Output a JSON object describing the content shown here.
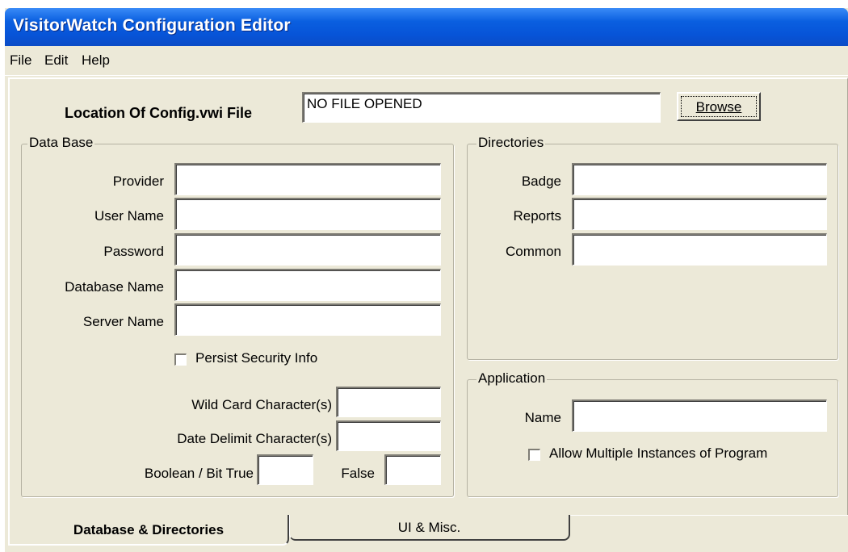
{
  "window": {
    "title": "VisitorWatch Configuration Editor"
  },
  "menu": [
    "File",
    "Edit",
    "Help"
  ],
  "config": {
    "label": "Location Of Config.vwi File",
    "path_value": "NO FILE OPENED",
    "browse_label": "Browse"
  },
  "database": {
    "legend": "Data Base",
    "fields": [
      {
        "label": "Provider",
        "value": ""
      },
      {
        "label": "User Name",
        "value": ""
      },
      {
        "label": "Password",
        "value": ""
      },
      {
        "label": "Database Name",
        "value": ""
      },
      {
        "label": "Server Name",
        "value": ""
      }
    ],
    "persist_label": "Persist Security Info",
    "persist_checked": false,
    "wildcard_label": "Wild Card Character(s)",
    "wildcard_value": "",
    "date_delimit_label": "Date Delimit Character(s)",
    "date_delimit_value": "",
    "bool_true_label": "Boolean / Bit True",
    "bool_true_value": "",
    "bool_false_label": "False",
    "bool_false_value": ""
  },
  "directories": {
    "legend": "Directories",
    "fields": [
      {
        "label": "Badge",
        "value": ""
      },
      {
        "label": "Reports",
        "value": ""
      },
      {
        "label": "Common",
        "value": ""
      }
    ]
  },
  "application": {
    "legend": "Application",
    "name_label": "Name",
    "name_value": "",
    "multi_label": "Allow Multiple Instances of Program",
    "multi_checked": false
  },
  "tabs": [
    {
      "label": "Database & Directories",
      "active": true
    },
    {
      "label": "UI & Misc.",
      "active": false
    }
  ]
}
